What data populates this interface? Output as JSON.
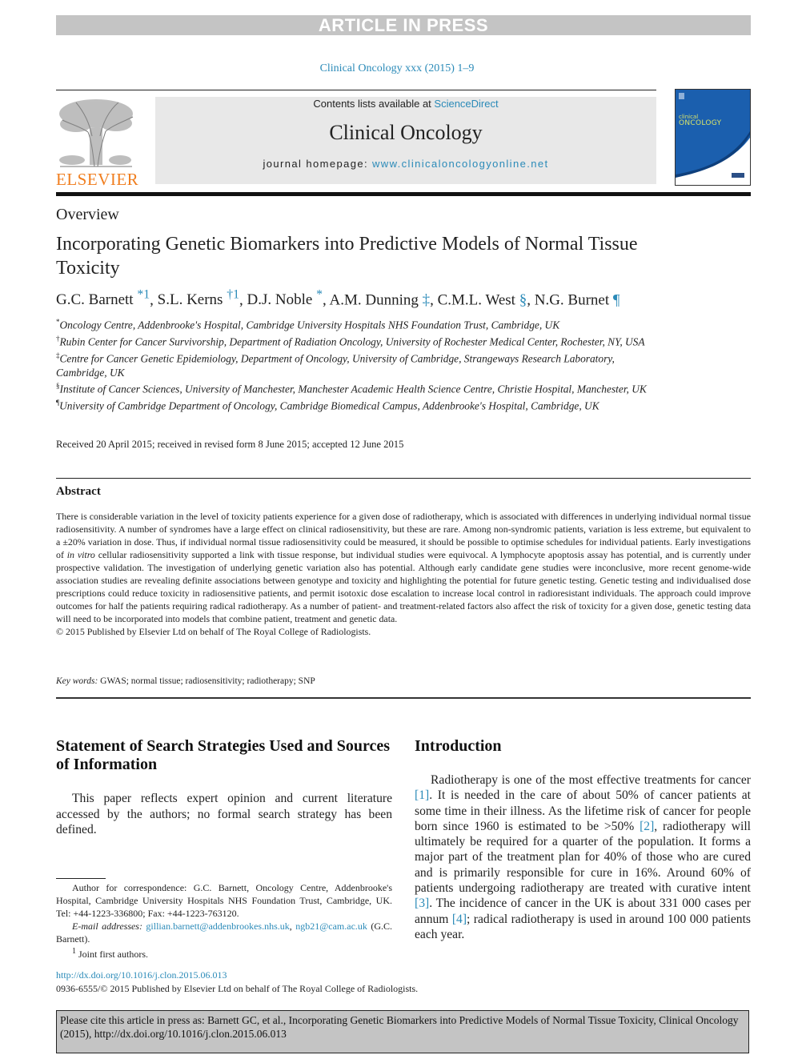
{
  "banner": "ARTICLE IN PRESS",
  "journal_citation": "Clinical Oncology xxx (2015) 1–9",
  "masthead": {
    "contents_prefix": "Contents lists available at ",
    "contents_link": "ScienceDirect",
    "journal_title": "Clinical Oncology",
    "homepage_prefix": "journal homepage: ",
    "homepage_link": "www.clinicaloncologyonline.net"
  },
  "publisher_logo": "ELSEVIER",
  "cover": {
    "line1": "clinical",
    "line2": "ONCOLOGY",
    "bg": "#1b5fae"
  },
  "article": {
    "type": "Overview",
    "title": "Incorporating Genetic Biomarkers into Predictive Models of Normal Tissue Toxicity",
    "authors": [
      {
        "name": "G.C. Barnett",
        "marks": "*1"
      },
      {
        "name": "S.L. Kerns",
        "marks": "†1"
      },
      {
        "name": "D.J. Noble",
        "marks": "*"
      },
      {
        "name": "A.M. Dunning",
        "marks": "‡"
      },
      {
        "name": "C.M.L. West",
        "marks": "§"
      },
      {
        "name": "N.G. Burnet",
        "marks": "¶"
      }
    ],
    "affiliations": [
      {
        "mark": "*",
        "text": "Oncology Centre, Addenbrooke's Hospital, Cambridge University Hospitals NHS Foundation Trust, Cambridge, UK"
      },
      {
        "mark": "†",
        "text": "Rubin Center for Cancer Survivorship, Department of Radiation Oncology, University of Rochester Medical Center, Rochester, NY, USA"
      },
      {
        "mark": "‡",
        "text": "Centre for Cancer Genetic Epidemiology, Department of Oncology, University of Cambridge, Strangeways Research Laboratory, Cambridge, UK"
      },
      {
        "mark": "§",
        "text": "Institute of Cancer Sciences, University of Manchester, Manchester Academic Health Science Centre, Christie Hospital, Manchester, UK"
      },
      {
        "mark": "¶",
        "text": "University of Cambridge Department of Oncology, Cambridge Biomedical Campus, Addenbrooke's Hospital, Cambridge, UK"
      }
    ],
    "received": "Received 20 April 2015; received in revised form 8 June 2015; accepted 12 June 2015"
  },
  "abstract": {
    "heading": "Abstract",
    "text_part1": "There is considerable variation in the level of toxicity patients experience for a given dose of radiotherapy, which is associated with differences in underlying individual normal tissue radiosensitivity. A number of syndromes have a large effect on clinical radiosensitivity, but these are rare. Among non-syndromic patients, variation is less extreme, but equivalent to a ±20% variation in dose. Thus, if individual normal tissue radiosensitivity could be measured, it should be possible to optimise schedules for individual patients. Early investigations of ",
    "text_italic": "in vitro",
    "text_part2": " cellular radiosensitivity supported a link with tissue response, but individual studies were equivocal. A lymphocyte apoptosis assay has potential, and is currently under prospective validation. The investigation of underlying genetic variation also has potential. Although early candidate gene studies were inconclusive, more recent genome-wide association studies are revealing definite associations between genotype and toxicity and highlighting the potential for future genetic testing. Genetic testing and individualised dose prescriptions could reduce toxicity in radiosensitive patients, and permit isotoxic dose escalation to increase local control in radioresistant individuals. The approach could improve outcomes for half the patients requiring radical radiotherapy. As a number of patient- and treatment-related factors also affect the risk of toxicity for a given dose, genetic testing data will need to be incorporated into models that combine patient, treatment and genetic data.",
    "copyright": "© 2015 Published by Elsevier Ltd on behalf of The Royal College of Radiologists."
  },
  "keywords": {
    "label": "Key words:",
    "text": " GWAS; normal tissue; radiosensitivity; radiotherapy; SNP"
  },
  "left_section": {
    "heading": "Statement of Search Strategies Used and Sources of Information",
    "paragraph": "This paper reflects expert opinion and current literature accessed by the authors; no formal search strategy has been defined."
  },
  "footnotes": {
    "correspondence": "Author for correspondence: G.C. Barnett, Oncology Centre, Addenbrooke's Hospital, Cambridge University Hospitals NHS Foundation Trust, Cambridge, UK. Tel: +44-1223-336800; Fax: +44-1223-763120.",
    "email_label": "E-mail addresses:",
    "email1": "gillian.barnett@addenbrookes.nhs.uk",
    "email2": "ngb21@cam.ac.uk",
    "email_suffix": " (G.C. Barnett).",
    "joint_mark": "1",
    "joint_text": " Joint first authors."
  },
  "introduction": {
    "heading": "Introduction",
    "segments": [
      {
        "t": "Radiotherapy is one of the most effective treatments for cancer "
      },
      {
        "ref": "[1]"
      },
      {
        "t": ". It is needed in the care of about 50% of cancer patients at some time in their illness. As the lifetime risk of cancer for people born since 1960 is estimated to be >50% "
      },
      {
        "ref": "[2]"
      },
      {
        "t": ", radiotherapy will ultimately be required for a quarter of the population. It forms a major part of the treatment plan for 40% of those who are cured and is primarily responsible for cure in 16%. Around 60% of patients undergoing radiotherapy are treated with curative intent "
      },
      {
        "ref": "[3]"
      },
      {
        "t": ". The incidence of cancer in the UK is about 331 000 cases per annum "
      },
      {
        "ref": "[4]"
      },
      {
        "t": "; radical radiotherapy is used in around 100 000 patients each year."
      }
    ]
  },
  "doi": {
    "link": "http://dx.doi.org/10.1016/j.clon.2015.06.013",
    "issn_line": "0936-6555/© 2015 Published by Elsevier Ltd on behalf of The Royal College of Radiologists."
  },
  "cite_box": "Please cite this article in press as: Barnett GC, et al., Incorporating Genetic Biomarkers into Predictive Models of Normal Tissue Toxicity, Clinical Oncology (2015), http://dx.doi.org/10.1016/j.clon.2015.06.013"
}
